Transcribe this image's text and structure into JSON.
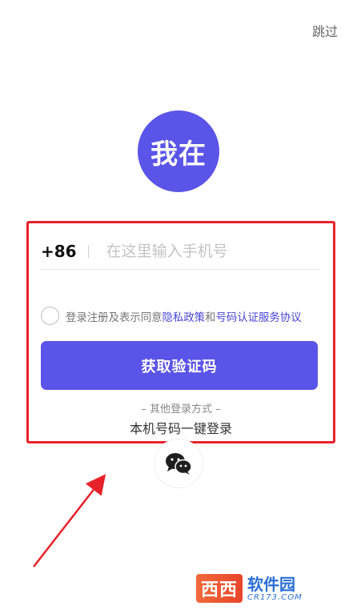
{
  "header": {
    "skip_label": "跳过"
  },
  "logo": {
    "text": "我在",
    "icon": "app-logo"
  },
  "login": {
    "country_code": "+86",
    "phone_placeholder": "在这里输入手机号",
    "agreement": {
      "prefix": "登录注册及表示同意",
      "privacy_link": "隐私政策",
      "conjunction": "和",
      "service_link": "号码认证服务协议"
    },
    "get_code_button": "获取验证码",
    "other_methods_title": "– 其他登录方式 –",
    "one_click_login": "本机号码一键登录"
  },
  "social": {
    "wechat_icon": "wechat-icon"
  },
  "watermark": {
    "badge": "西西",
    "main": "软件园",
    "sub": "CR173.COM"
  },
  "colors": {
    "brand": "#5b54e8",
    "highlight_border": "#e8222a",
    "link": "#4a45d6"
  }
}
